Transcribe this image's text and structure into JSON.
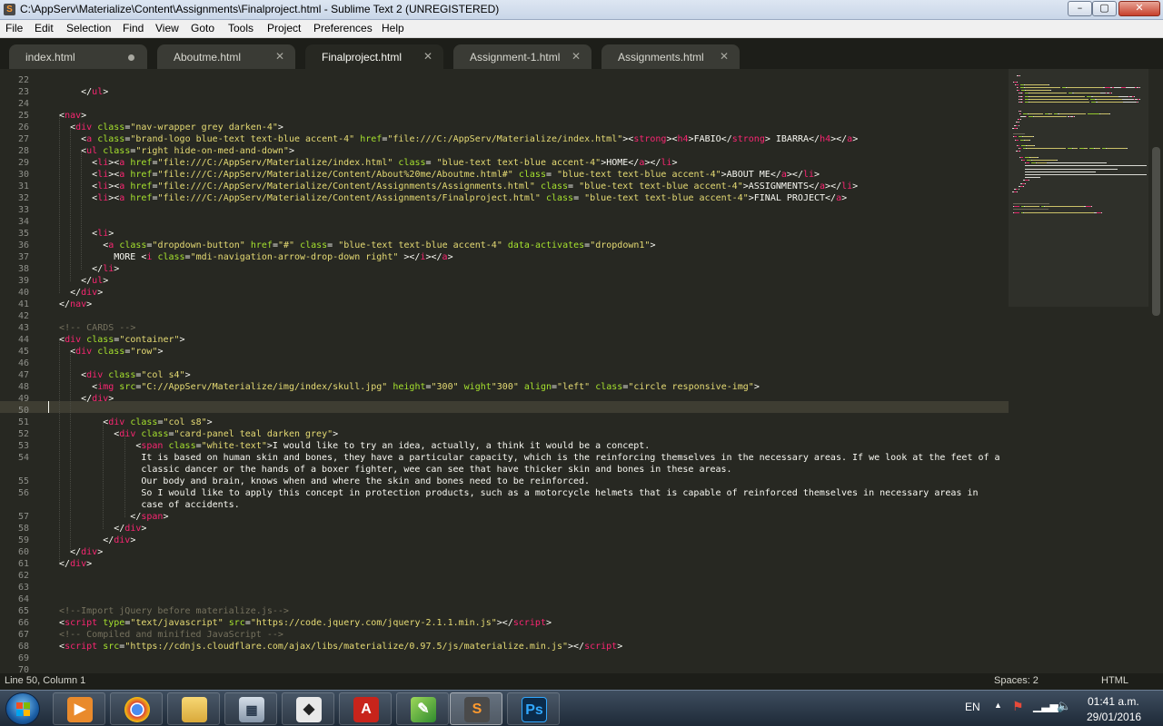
{
  "window": {
    "title": "C:\\AppServ\\Materialize\\Content\\Assignments\\Finalproject.html - Sublime Text 2 (UNREGISTERED)",
    "minimize": "–",
    "maximize": "▢",
    "close": "✕"
  },
  "menu": [
    "File",
    "Edit",
    "Selection",
    "Find",
    "View",
    "Goto",
    "Tools",
    "Project",
    "Preferences",
    "Help"
  ],
  "tabs": [
    {
      "label": "index.html",
      "state": "modified"
    },
    {
      "label": "Aboutme.html",
      "state": "close"
    },
    {
      "label": "Finalproject.html",
      "state": "active"
    },
    {
      "label": "Assignment-1.html",
      "state": "close"
    },
    {
      "label": "Assignments.html",
      "state": "close"
    }
  ],
  "colors": {
    "tag": "#f92672",
    "attr": "#a6e22e",
    "string": "#e6db74",
    "text": "#f8f8f2",
    "comment": "#75715e",
    "background": "#272822"
  },
  "line_numbers": [
    "22",
    "23",
    "24",
    "25",
    "26",
    "27",
    "28",
    "29",
    "30",
    "31",
    "32",
    "33",
    "34",
    "35",
    "36",
    "37",
    "38",
    "39",
    "40",
    "41",
    "42",
    "43",
    "44",
    "45",
    "46",
    "47",
    "48",
    "49",
    "50",
    "51",
    "52",
    "53",
    "54",
    "",
    "55",
    "56",
    "",
    "57",
    "58",
    "59",
    "60",
    "61",
    "62",
    "63",
    "64",
    "65",
    "66",
    "67",
    "68",
    "69",
    "70"
  ],
  "code_lines": [
    [],
    [
      [
        "      ",
        "t"
      ],
      [
        "</",
        "t"
      ],
      [
        "ul",
        "g"
      ],
      [
        ">",
        "t"
      ]
    ],
    [],
    [
      [
        "  ",
        "t"
      ],
      [
        "<",
        "t"
      ],
      [
        "nav",
        "g"
      ],
      [
        ">",
        "t"
      ]
    ],
    [
      [
        "    ",
        "t"
      ],
      [
        "<",
        "t"
      ],
      [
        "div",
        "g"
      ],
      [
        " ",
        "t"
      ],
      [
        "class",
        "a"
      ],
      [
        "=",
        "t"
      ],
      [
        "\"nav-wrapper grey darken-4\"",
        "s"
      ],
      [
        ">",
        "t"
      ]
    ],
    [
      [
        "      ",
        "t"
      ],
      [
        "<",
        "t"
      ],
      [
        "a",
        "g"
      ],
      [
        " ",
        "t"
      ],
      [
        "class",
        "a"
      ],
      [
        "=",
        "t"
      ],
      [
        "\"brand-logo blue-text text-blue accent-4\"",
        "s"
      ],
      [
        " ",
        "t"
      ],
      [
        "href",
        "a"
      ],
      [
        "=",
        "t"
      ],
      [
        "\"file:///C:/AppServ/Materialize/index.html\"",
        "s"
      ],
      [
        ">",
        "t"
      ],
      [
        "<",
        "t"
      ],
      [
        "strong",
        "g"
      ],
      [
        ">",
        "t"
      ],
      [
        "<",
        "t"
      ],
      [
        "h4",
        "g"
      ],
      [
        ">FABIO</",
        "t"
      ],
      [
        "strong",
        "g"
      ],
      [
        "> IBARRA</",
        "t"
      ],
      [
        "h4",
        "g"
      ],
      [
        "></",
        "t"
      ],
      [
        "a",
        "g"
      ],
      [
        ">",
        "t"
      ]
    ],
    [
      [
        "      ",
        "t"
      ],
      [
        "<",
        "t"
      ],
      [
        "ul",
        "g"
      ],
      [
        " ",
        "t"
      ],
      [
        "class",
        "a"
      ],
      [
        "=",
        "t"
      ],
      [
        "\"right hide-on-med-and-down\"",
        "s"
      ],
      [
        ">",
        "t"
      ]
    ],
    [
      [
        "        ",
        "t"
      ],
      [
        "<",
        "t"
      ],
      [
        "li",
        "g"
      ],
      [
        "><",
        "t"
      ],
      [
        "a",
        "g"
      ],
      [
        " ",
        "t"
      ],
      [
        "href",
        "a"
      ],
      [
        "=",
        "t"
      ],
      [
        "\"file:///C:/AppServ/Materialize/index.html\"",
        "s"
      ],
      [
        " ",
        "t"
      ],
      [
        "class",
        "a"
      ],
      [
        "= ",
        "t"
      ],
      [
        "\"blue-text text-blue accent-4\"",
        "s"
      ],
      [
        ">HOME</",
        "t"
      ],
      [
        "a",
        "g"
      ],
      [
        "></",
        "t"
      ],
      [
        "li",
        "g"
      ],
      [
        ">",
        "t"
      ]
    ],
    [
      [
        "        ",
        "t"
      ],
      [
        "<",
        "t"
      ],
      [
        "li",
        "g"
      ],
      [
        "><",
        "t"
      ],
      [
        "a",
        "g"
      ],
      [
        " ",
        "t"
      ],
      [
        "href",
        "a"
      ],
      [
        "=",
        "t"
      ],
      [
        "\"file:///C:/AppServ/Materialize/Content/About%20me/Aboutme.html#\"",
        "s"
      ],
      [
        " ",
        "t"
      ],
      [
        "class",
        "a"
      ],
      [
        "= ",
        "t"
      ],
      [
        "\"blue-text text-blue accent-4\"",
        "s"
      ],
      [
        ">ABOUT ME</",
        "t"
      ],
      [
        "a",
        "g"
      ],
      [
        "></",
        "t"
      ],
      [
        "li",
        "g"
      ],
      [
        ">",
        "t"
      ]
    ],
    [
      [
        "        ",
        "t"
      ],
      [
        "<",
        "t"
      ],
      [
        "li",
        "g"
      ],
      [
        "><",
        "t"
      ],
      [
        "a",
        "g"
      ],
      [
        " ",
        "t"
      ],
      [
        "href",
        "a"
      ],
      [
        "=",
        "t"
      ],
      [
        "\"file:///C:/AppServ/Materialize/Content/Assignments/Assignments.html\"",
        "s"
      ],
      [
        " ",
        "t"
      ],
      [
        "class",
        "a"
      ],
      [
        "= ",
        "t"
      ],
      [
        "\"blue-text text-blue accent-4\"",
        "s"
      ],
      [
        ">ASSIGNMENTS</",
        "t"
      ],
      [
        "a",
        "g"
      ],
      [
        "></",
        "t"
      ],
      [
        "li",
        "g"
      ],
      [
        ">",
        "t"
      ]
    ],
    [
      [
        "        ",
        "t"
      ],
      [
        "<",
        "t"
      ],
      [
        "li",
        "g"
      ],
      [
        "><",
        "t"
      ],
      [
        "a",
        "g"
      ],
      [
        " ",
        "t"
      ],
      [
        "href",
        "a"
      ],
      [
        "=",
        "t"
      ],
      [
        "\"file:///C:/AppServ/Materialize/Content/Assignments/Finalproject.html\"",
        "s"
      ],
      [
        " ",
        "t"
      ],
      [
        "class",
        "a"
      ],
      [
        "= ",
        "t"
      ],
      [
        "\"blue-text text-blue accent-4\"",
        "s"
      ],
      [
        ">FINAL PROJECT</",
        "t"
      ],
      [
        "a",
        "g"
      ],
      [
        ">",
        "t"
      ]
    ],
    [],
    [],
    [
      [
        "        ",
        "t"
      ],
      [
        "<",
        "t"
      ],
      [
        "li",
        "g"
      ],
      [
        ">",
        "t"
      ]
    ],
    [
      [
        "          ",
        "t"
      ],
      [
        "<",
        "t"
      ],
      [
        "a",
        "g"
      ],
      [
        " ",
        "t"
      ],
      [
        "class",
        "a"
      ],
      [
        "=",
        "t"
      ],
      [
        "\"dropdown-button\"",
        "s"
      ],
      [
        " ",
        "t"
      ],
      [
        "href",
        "a"
      ],
      [
        "=",
        "t"
      ],
      [
        "\"#\"",
        "s"
      ],
      [
        " ",
        "t"
      ],
      [
        "class",
        "a"
      ],
      [
        "= ",
        "t"
      ],
      [
        "\"blue-text text-blue accent-4\"",
        "s"
      ],
      [
        " ",
        "t"
      ],
      [
        "data-activates",
        "a"
      ],
      [
        "=",
        "t"
      ],
      [
        "\"dropdown1\"",
        "s"
      ],
      [
        ">",
        "t"
      ]
    ],
    [
      [
        "            MORE <",
        "t"
      ],
      [
        "i",
        "g"
      ],
      [
        " ",
        "t"
      ],
      [
        "class",
        "a"
      ],
      [
        "=",
        "t"
      ],
      [
        "\"mdi-navigation-arrow-drop-down right\"",
        "s"
      ],
      [
        " ></",
        "t"
      ],
      [
        "i",
        "g"
      ],
      [
        "></",
        "t"
      ],
      [
        "a",
        "g"
      ],
      [
        ">",
        "t"
      ]
    ],
    [
      [
        "        </",
        "t"
      ],
      [
        "li",
        "g"
      ],
      [
        ">",
        "t"
      ]
    ],
    [
      [
        "      </",
        "t"
      ],
      [
        "ul",
        "g"
      ],
      [
        ">",
        "t"
      ]
    ],
    [
      [
        "    </",
        "t"
      ],
      [
        "div",
        "g"
      ],
      [
        ">",
        "t"
      ]
    ],
    [
      [
        "  </",
        "t"
      ],
      [
        "nav",
        "g"
      ],
      [
        ">",
        "t"
      ]
    ],
    [],
    [
      [
        "  ",
        "t"
      ],
      [
        "<!-- CARDS -->",
        "c"
      ]
    ],
    [
      [
        "  ",
        "t"
      ],
      [
        "<",
        "t"
      ],
      [
        "div",
        "g"
      ],
      [
        " ",
        "t"
      ],
      [
        "class",
        "a"
      ],
      [
        "=",
        "t"
      ],
      [
        "\"container\"",
        "s"
      ],
      [
        ">",
        "t"
      ]
    ],
    [
      [
        "    ",
        "t"
      ],
      [
        "<",
        "t"
      ],
      [
        "div",
        "g"
      ],
      [
        " ",
        "t"
      ],
      [
        "class",
        "a"
      ],
      [
        "=",
        "t"
      ],
      [
        "\"row\"",
        "s"
      ],
      [
        ">",
        "t"
      ]
    ],
    [],
    [
      [
        "      ",
        "t"
      ],
      [
        "<",
        "t"
      ],
      [
        "div",
        "g"
      ],
      [
        " ",
        "t"
      ],
      [
        "class",
        "a"
      ],
      [
        "=",
        "t"
      ],
      [
        "\"col s4\"",
        "s"
      ],
      [
        ">",
        "t"
      ]
    ],
    [
      [
        "        ",
        "t"
      ],
      [
        "<",
        "t"
      ],
      [
        "img",
        "g"
      ],
      [
        " ",
        "t"
      ],
      [
        "src",
        "a"
      ],
      [
        "=",
        "t"
      ],
      [
        "\"C://AppServ/Materialize/img/index/skull.jpg\"",
        "s"
      ],
      [
        " ",
        "t"
      ],
      [
        "height",
        "a"
      ],
      [
        "=",
        "t"
      ],
      [
        "\"300\"",
        "s"
      ],
      [
        " ",
        "t"
      ],
      [
        "wight",
        "a"
      ],
      [
        "\"300\"",
        "s"
      ],
      [
        " ",
        "t"
      ],
      [
        "align",
        "a"
      ],
      [
        "=",
        "t"
      ],
      [
        "\"left\"",
        "s"
      ],
      [
        " ",
        "t"
      ],
      [
        "class",
        "a"
      ],
      [
        "=",
        "t"
      ],
      [
        "\"circle responsive-img\"",
        "s"
      ],
      [
        ">",
        "t"
      ]
    ],
    [
      [
        "      </",
        "t"
      ],
      [
        "div",
        "g"
      ],
      [
        ">",
        "t"
      ]
    ],
    [],
    [
      [
        "          ",
        "t"
      ],
      [
        "<",
        "t"
      ],
      [
        "div",
        "g"
      ],
      [
        " ",
        "t"
      ],
      [
        "class",
        "a"
      ],
      [
        "=",
        "t"
      ],
      [
        "\"col s8\"",
        "s"
      ],
      [
        ">",
        "t"
      ]
    ],
    [
      [
        "            ",
        "t"
      ],
      [
        "<",
        "t"
      ],
      [
        "div",
        "g"
      ],
      [
        " ",
        "t"
      ],
      [
        "class",
        "a"
      ],
      [
        "=",
        "t"
      ],
      [
        "\"card-panel teal darken grey\"",
        "s"
      ],
      [
        ">",
        "t"
      ]
    ],
    [
      [
        "                ",
        "t"
      ],
      [
        "<",
        "t"
      ],
      [
        "span",
        "g"
      ],
      [
        " ",
        "t"
      ],
      [
        "class",
        "a"
      ],
      [
        "=",
        "t"
      ],
      [
        "\"white-text\"",
        "s"
      ],
      [
        ">I would like to try an idea, actually, a think it would be a concept.",
        "t"
      ]
    ],
    [
      [
        "                 It is based on human skin and bones, they have a particular capacity, which is the reinforcing themselves in the necessary areas. If we look at the feet of a",
        "t"
      ]
    ],
    [
      [
        "                 classic dancer or the hands of a boxer fighter, wee can see that have thicker skin and bones in these areas.",
        "t"
      ]
    ],
    [
      [
        "                 Our body and brain, knows when and where the skin and bones need to be reinforced.",
        "t"
      ]
    ],
    [
      [
        "                 So I would like to apply this concept in protection products, such as a motorcycle helmets that is capable of reinforced themselves in necessary areas in",
        "t"
      ]
    ],
    [
      [
        "                 case of accidents.",
        "t"
      ]
    ],
    [
      [
        "               </",
        "t"
      ],
      [
        "span",
        "g"
      ],
      [
        ">",
        "t"
      ]
    ],
    [
      [
        "            </",
        "t"
      ],
      [
        "div",
        "g"
      ],
      [
        ">",
        "t"
      ]
    ],
    [
      [
        "          </",
        "t"
      ],
      [
        "div",
        "g"
      ],
      [
        ">",
        "t"
      ]
    ],
    [
      [
        "    </",
        "t"
      ],
      [
        "div",
        "g"
      ],
      [
        ">",
        "t"
      ]
    ],
    [
      [
        "  </",
        "t"
      ],
      [
        "div",
        "g"
      ],
      [
        ">",
        "t"
      ]
    ],
    [],
    [],
    [],
    [
      [
        "  ",
        "t"
      ],
      [
        "<!--Import jQuery before materialize.js-->",
        "c"
      ]
    ],
    [
      [
        "  ",
        "t"
      ],
      [
        "<",
        "t"
      ],
      [
        "script",
        "g"
      ],
      [
        " ",
        "t"
      ],
      [
        "type",
        "a"
      ],
      [
        "=",
        "t"
      ],
      [
        "\"text/javascript\"",
        "s"
      ],
      [
        " ",
        "t"
      ],
      [
        "src",
        "a"
      ],
      [
        "=",
        "t"
      ],
      [
        "\"https://code.jquery.com/jquery-2.1.1.min.js\"",
        "s"
      ],
      [
        "></",
        "t"
      ],
      [
        "script",
        "g"
      ],
      [
        ">",
        "t"
      ]
    ],
    [
      [
        "  ",
        "t"
      ],
      [
        "<!-- Compiled and minified JavaScript -->",
        "c"
      ]
    ],
    [
      [
        "  ",
        "t"
      ],
      [
        "<",
        "t"
      ],
      [
        "script",
        "g"
      ],
      [
        " ",
        "t"
      ],
      [
        "src",
        "a"
      ],
      [
        "=",
        "t"
      ],
      [
        "\"https://cdnjs.cloudflare.com/ajax/libs/materialize/0.97.5/js/materialize.min.js\"",
        "s"
      ],
      [
        "></",
        "t"
      ],
      [
        "script",
        "g"
      ],
      [
        ">",
        "t"
      ]
    ],
    [],
    []
  ],
  "status": {
    "position": "Line 50, Column 1",
    "indent": "Spaces: 2",
    "syntax": "HTML"
  },
  "taskbar": {
    "apps": [
      "Windows Media Player",
      "Google Chrome",
      "Windows Explorer",
      "Calculator",
      "Inkscape",
      "AutoCAD",
      "Sketch",
      "Sublime Text",
      "Photoshop"
    ],
    "photoshop_label": "Ps",
    "sublime_label": "S",
    "language": "EN",
    "time": "01:41 a.m.",
    "date": "29/01/2016"
  }
}
